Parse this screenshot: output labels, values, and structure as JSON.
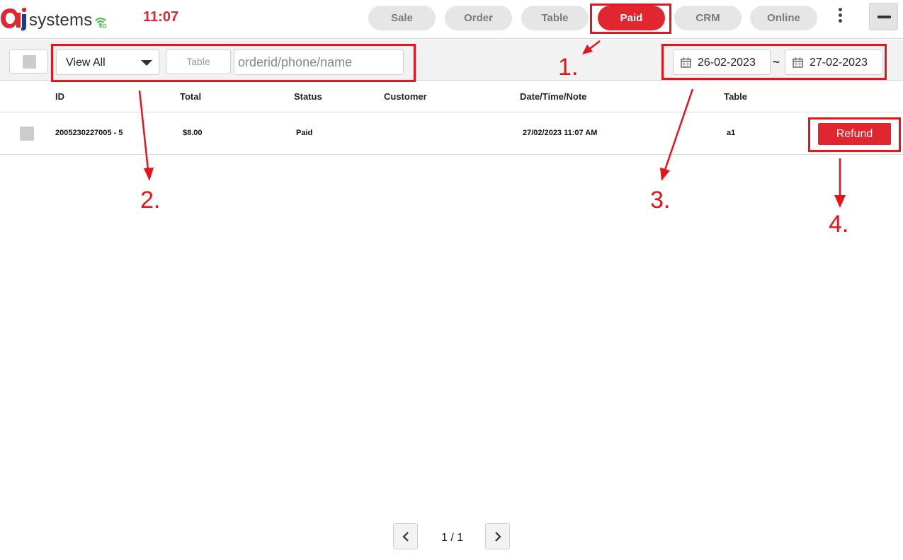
{
  "header": {
    "logo_text": "systems",
    "clock": "11:07",
    "nav": [
      {
        "label": "Sale",
        "active": false
      },
      {
        "label": "Order",
        "active": false
      },
      {
        "label": "Table",
        "active": false
      },
      {
        "label": "Paid",
        "active": true
      },
      {
        "label": "CRM",
        "active": false
      },
      {
        "label": "Online",
        "active": false
      }
    ],
    "icons": {
      "logo": "ai-logo-mark",
      "wifi": "wifi-icon",
      "more": "kebab-menu-icon",
      "minimize": "minimize-icon"
    }
  },
  "toolbar": {
    "filter_select": "View All",
    "table_filter_label": "Table",
    "search_placeholder": "orderid/phone/name",
    "date_from": "26-02-2023",
    "date_separator": "~",
    "date_to": "27-02-2023"
  },
  "table": {
    "columns": [
      "ID",
      "Total",
      "Status",
      "Customer",
      "Date/Time/Note",
      "Table"
    ],
    "rows": [
      {
        "id": "2005230227005 - 5",
        "total": "$8.00",
        "status": "Paid",
        "customer": "",
        "datetime": "27/02/2023 11:07 AM",
        "table": "a1",
        "action_label": "Refund"
      }
    ]
  },
  "pagination": {
    "label": "1 / 1"
  },
  "annotations": [
    "1.",
    "2.",
    "3.",
    "4."
  ],
  "colors": {
    "brand_red": "#e2262f",
    "annotation_red": "#e8141c",
    "wifi_green": "#36c23a",
    "nav_inactive": "#e6e6e6"
  }
}
